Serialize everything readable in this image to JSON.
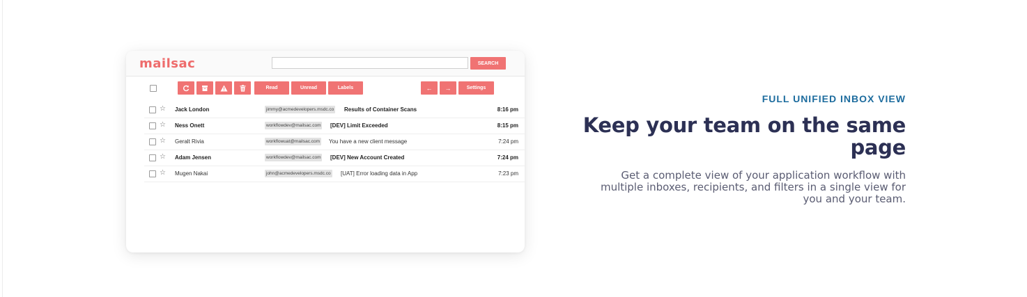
{
  "app": {
    "logo": "mailsac",
    "search": {
      "placeholder": "",
      "button_label": "SEARCH"
    }
  },
  "toolbar": {
    "icons": [
      "refresh-icon",
      "archive-icon",
      "warning-icon",
      "trash-icon"
    ],
    "read_label": "Read",
    "unread_label": "Unread",
    "labels_label": "Labels",
    "prev_label": "←",
    "next_label": "→",
    "settings_label": "Settings"
  },
  "messages": [
    {
      "sender": "Jack London",
      "address": "jimmy@acmedevelopers.msdc.co",
      "subject": "Results of Container Scans",
      "time": "8:16 pm",
      "unread": true
    },
    {
      "sender": "Ness Onett",
      "address": "workflowdev@mailsac.com",
      "subject": "[DEV] Limit Exceeded",
      "time": "8:15 pm",
      "unread": true
    },
    {
      "sender": "Geralt Rivia",
      "address": "workflowuat@mailsac.com",
      "subject": "You have a new client message",
      "time": "7:24 pm",
      "unread": false
    },
    {
      "sender": "Adam Jensen",
      "address": "workflowdev@mailsac.com",
      "subject": "[DEV] New Account Created",
      "time": "7:24 pm",
      "unread": true
    },
    {
      "sender": "Mugen Nakai",
      "address": "john@acmedevelopers.msdc.co",
      "subject": "[UAT] Error loading data in App",
      "time": "7:23 pm",
      "unread": false
    }
  ],
  "feature": {
    "eyebrow": "FULL UNIFIED INBOX VIEW",
    "headline": "Keep your team on the same page",
    "description": "Get a complete view of your application workflow with multiple inboxes, recipients, and filters in a single view for you and your team."
  },
  "colors": {
    "brand": "#ee6c6c",
    "button": "#f07373",
    "eyebrow": "#1d6c9e",
    "headline": "#2c3054",
    "body_text": "#5a5c72"
  }
}
